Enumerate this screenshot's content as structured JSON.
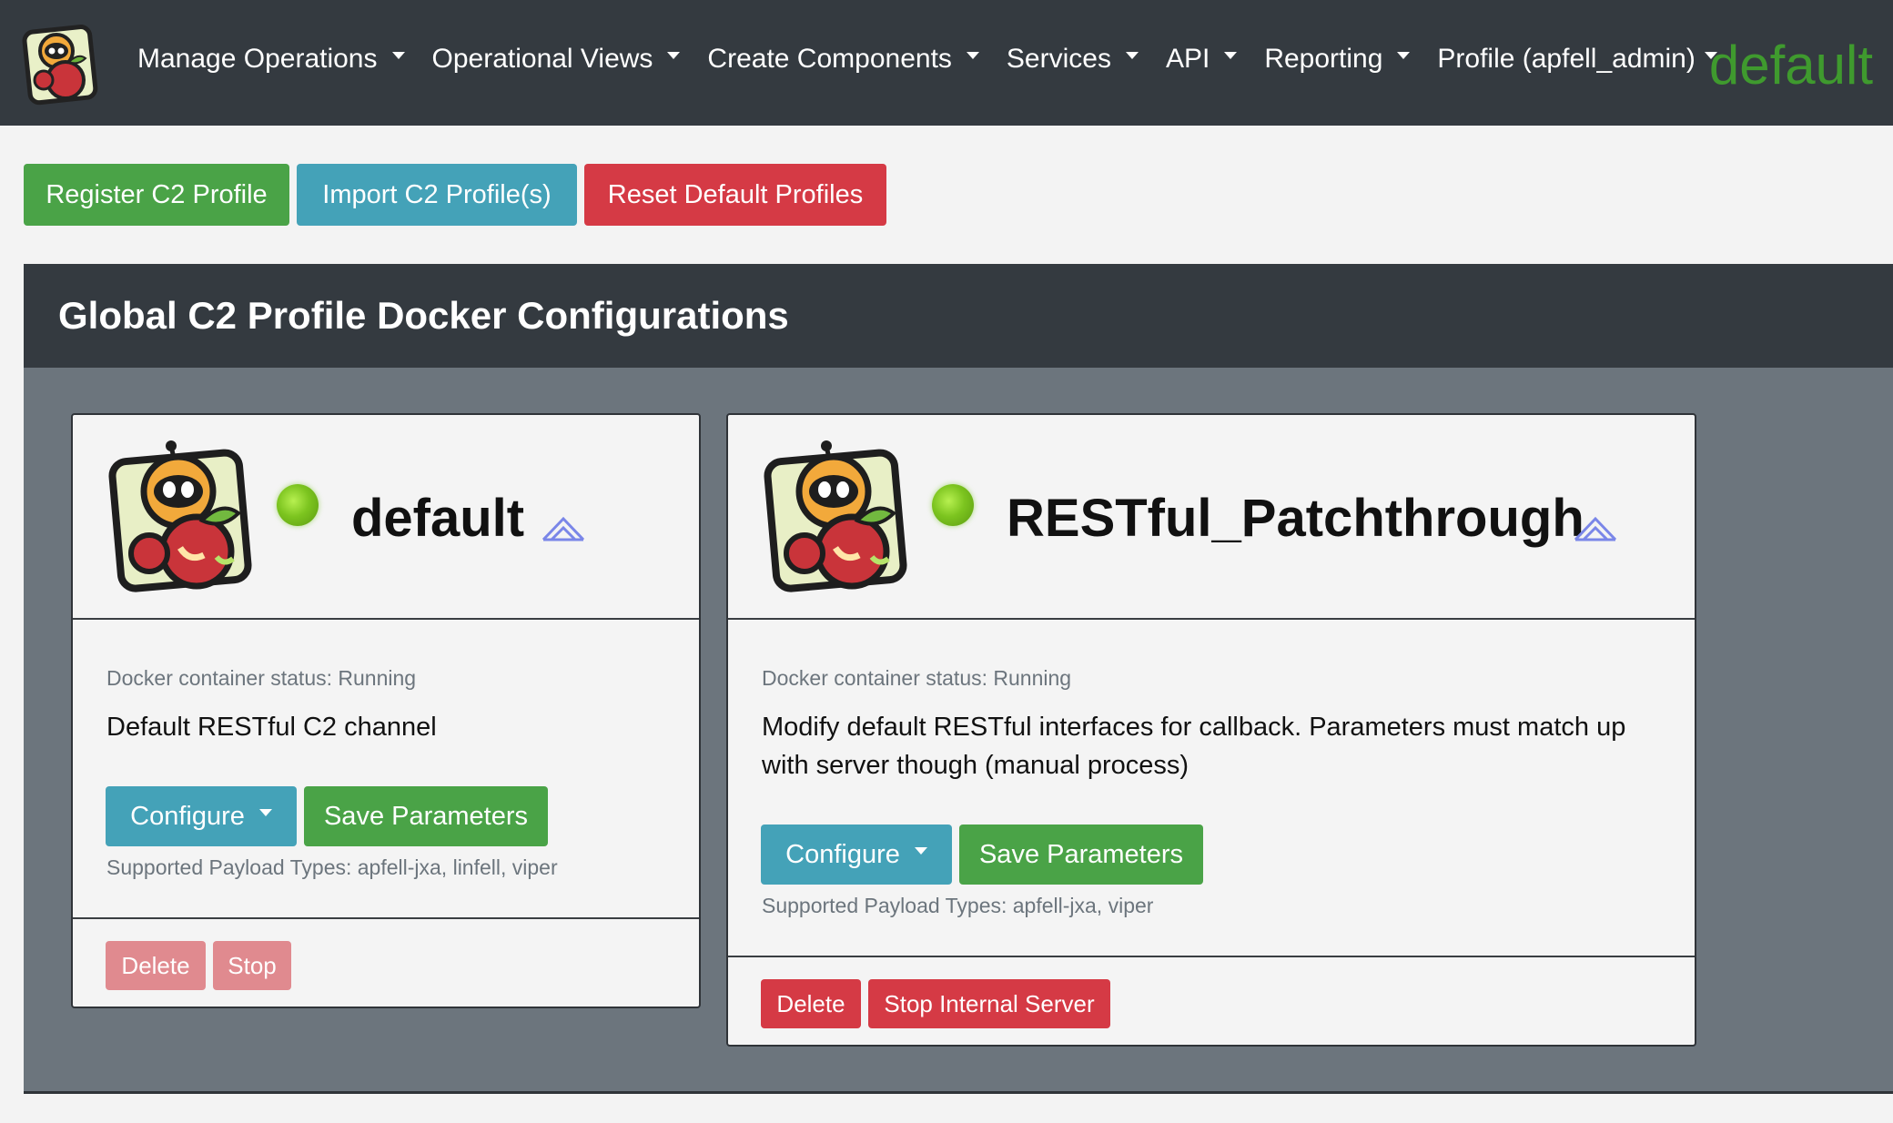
{
  "navbar": {
    "items": [
      {
        "label": "Manage Operations"
      },
      {
        "label": "Operational Views"
      },
      {
        "label": "Create Components"
      },
      {
        "label": "Services"
      },
      {
        "label": "API"
      },
      {
        "label": "Reporting"
      },
      {
        "label": "Profile (apfell_admin)"
      }
    ],
    "current_operation": "default"
  },
  "toolbar": {
    "register_label": "Register C2 Profile",
    "import_label": "Import C2 Profile(s)",
    "reset_label": "Reset Default Profiles"
  },
  "section": {
    "title": "Global C2 Profile Docker Configurations"
  },
  "cards": [
    {
      "name": "default",
      "status": "Docker container status: Running",
      "description": "Default RESTful C2 channel",
      "configure_label": "Configure",
      "save_label": "Save Parameters",
      "payload_types": "Supported Payload Types: apfell-jxa, linfell, viper",
      "delete_label": "Delete",
      "stop_label": "Stop"
    },
    {
      "name": "RESTful_Patchthrough",
      "status": "Docker container status: Running",
      "description": "Modify default RESTful interfaces for callback. Parameters must match up with server though (manual process)",
      "configure_label": "Configure",
      "save_label": "Save Parameters",
      "payload_types": "Supported Payload Types: apfell-jxa, viper",
      "delete_label": "Delete",
      "stop_label": "Stop Internal Server"
    }
  ],
  "colors": {
    "navbar_bg": "#343a40",
    "green": "#4aa347",
    "teal": "#44a2b8",
    "red": "#d53a45",
    "section_bg": "#6c757d",
    "status_running": "#7cc41f"
  },
  "icons": {
    "logo": "apfell-mascot-icon",
    "status": "status-running-icon",
    "collapse": "chevron-up-icon"
  }
}
